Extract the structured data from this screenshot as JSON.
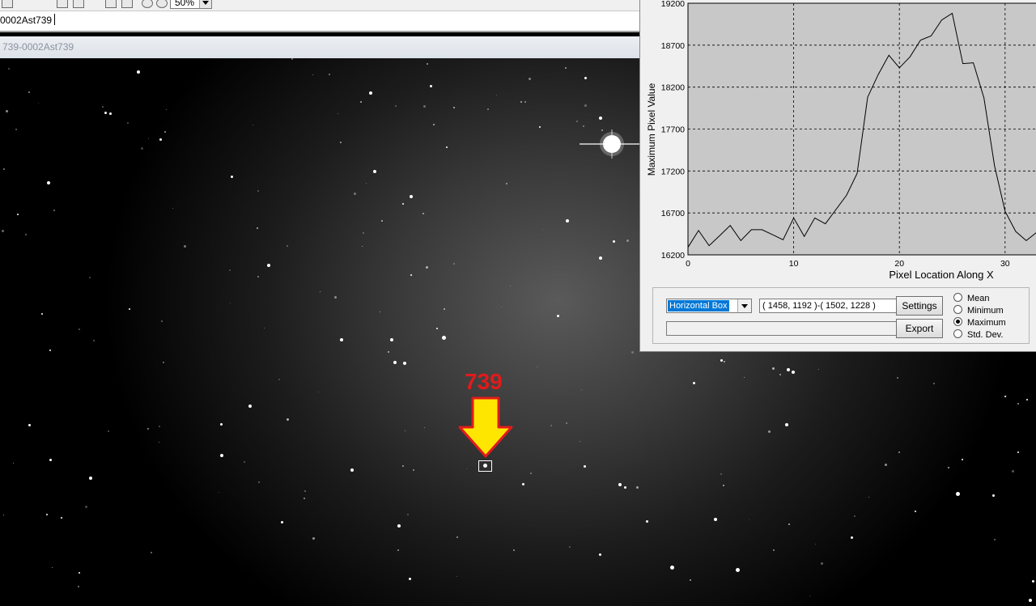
{
  "toolbar": {
    "zoom_value": "50%",
    "icons": [
      "open-icon",
      "save-icon",
      "copy-icon",
      "paste-icon",
      "zoom-in-icon",
      "zoom-out-icon",
      "pointer-icon"
    ]
  },
  "image_window": {
    "name_field": "0002Ast739",
    "subtitle": "739-0002Ast739"
  },
  "annotation": {
    "label": "739",
    "arrow_color": "#ffe600",
    "arrow_outline_color": "#e01b1b"
  },
  "profile": {
    "mode_selected": "Horizontal Box",
    "coords": "( 1458, 1192 )-( 1502, 1228 )",
    "settings_label": "Settings",
    "export_label": "Export",
    "radio_options": [
      "Mean",
      "Minimum",
      "Maximum",
      "Std. Dev."
    ],
    "radio_selected": "Maximum"
  },
  "chart_data": {
    "type": "line",
    "xlabel": "Pixel Location Along X",
    "ylabel": "Maximum Pixel Value",
    "x_ticks": [
      "0",
      "10",
      "20",
      "30"
    ],
    "y_ticks": [
      "16200",
      "16700",
      "17200",
      "17700",
      "18200",
      "18700",
      "19200"
    ],
    "xlim": [
      0,
      33
    ],
    "ylim": [
      16200,
      19200
    ],
    "grid": true,
    "series": [
      {
        "x": [
          0,
          1,
          2,
          3,
          4,
          5,
          6,
          7,
          8,
          9,
          10,
          11,
          12,
          13,
          14,
          15,
          16,
          17,
          18,
          19,
          20,
          21,
          22,
          23,
          24,
          25,
          26,
          27,
          28,
          29,
          30,
          31,
          32,
          33
        ],
        "values": [
          16290,
          16490,
          16310,
          16430,
          16550,
          16370,
          16500,
          16500,
          16440,
          16380,
          16640,
          16420,
          16640,
          16570,
          16740,
          16910,
          17170,
          18080,
          18350,
          18580,
          18430,
          18560,
          18760,
          18810,
          19000,
          19080,
          18480,
          18490,
          18070,
          17260,
          16720,
          16480,
          16370,
          16470
        ]
      }
    ]
  }
}
